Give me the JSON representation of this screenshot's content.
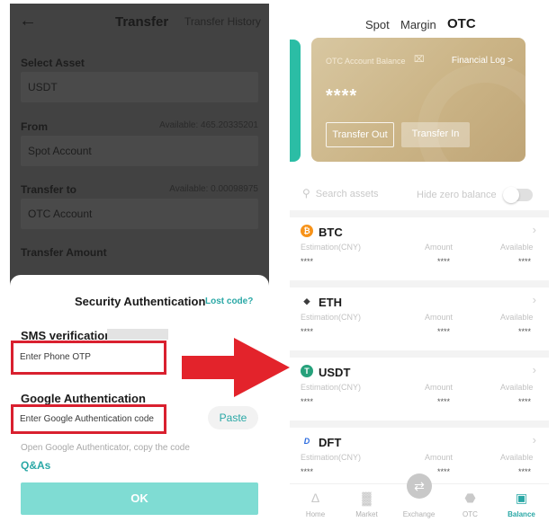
{
  "left": {
    "header": {
      "back_icon": "back-arrow-icon",
      "title": "Transfer",
      "history_link": "Transfer History"
    },
    "select_asset": {
      "label": "Select Asset",
      "value": "USDT"
    },
    "from": {
      "label": "From",
      "available": "Available: 465.20335201",
      "value": "Spot Account"
    },
    "transfer_to": {
      "label": "Transfer to",
      "available": "Available: 0.00098975",
      "value": "OTC Account"
    },
    "amount": {
      "label": "Transfer Amount"
    },
    "security": {
      "title": "Security Authentication",
      "lost_code": "Lost code?",
      "sms_label": "SMS verification",
      "sms_placeholder": "Enter Phone OTP",
      "google_label": "Google Authentication",
      "google_placeholder": "Enter Google Authentication code",
      "paste": "Paste",
      "hint": "Open Google Authenticator, copy the code",
      "qa": "Q&As",
      "ok": "OK"
    },
    "highlight_color": "#d9202f"
  },
  "arrow": {
    "color": "#e3232b"
  },
  "right": {
    "tabs": [
      {
        "label": "Spot",
        "active": false
      },
      {
        "label": "Margin",
        "active": false
      },
      {
        "label": "OTC",
        "active": true
      }
    ],
    "card": {
      "balance_label": "OTC Account Balance",
      "eye_icon": "eye-hidden-icon",
      "financial_log": "Financial Log >",
      "balance": "****",
      "transfer_out": "Transfer Out",
      "transfer_in": "Transfer In"
    },
    "search_placeholder": "Search assets",
    "hide_zero": "Hide zero balance",
    "columns": {
      "estimation": "Estimation(CNY)",
      "amount": "Amount",
      "available": "Available"
    },
    "assets": [
      {
        "name": "BTC",
        "icon": "bitcoin-icon",
        "color": "#f7931a",
        "estimation": "****",
        "amount": "****",
        "available": "****"
      },
      {
        "name": "ETH",
        "icon": "ethereum-icon",
        "color": "#3c3c3d",
        "estimation": "****",
        "amount": "****",
        "available": "****"
      },
      {
        "name": "USDT",
        "icon": "tether-icon",
        "color": "#26a17b",
        "estimation": "****",
        "amount": "****",
        "available": "****"
      },
      {
        "name": "DFT",
        "icon": "dft-icon",
        "color": "#2d6cdf",
        "estimation": "****",
        "amount": "****",
        "available": "****"
      }
    ],
    "nav": [
      {
        "label": "Home",
        "icon": "home-icon",
        "active": false
      },
      {
        "label": "Market",
        "icon": "market-chart-icon",
        "active": false
      },
      {
        "label": "Exchange",
        "icon": "exchange-icon",
        "active": false
      },
      {
        "label": "OTC",
        "icon": "otc-icon",
        "active": false
      },
      {
        "label": "Balance",
        "icon": "wallet-icon",
        "active": true
      }
    ],
    "accent_color": "#2aa8a6"
  }
}
